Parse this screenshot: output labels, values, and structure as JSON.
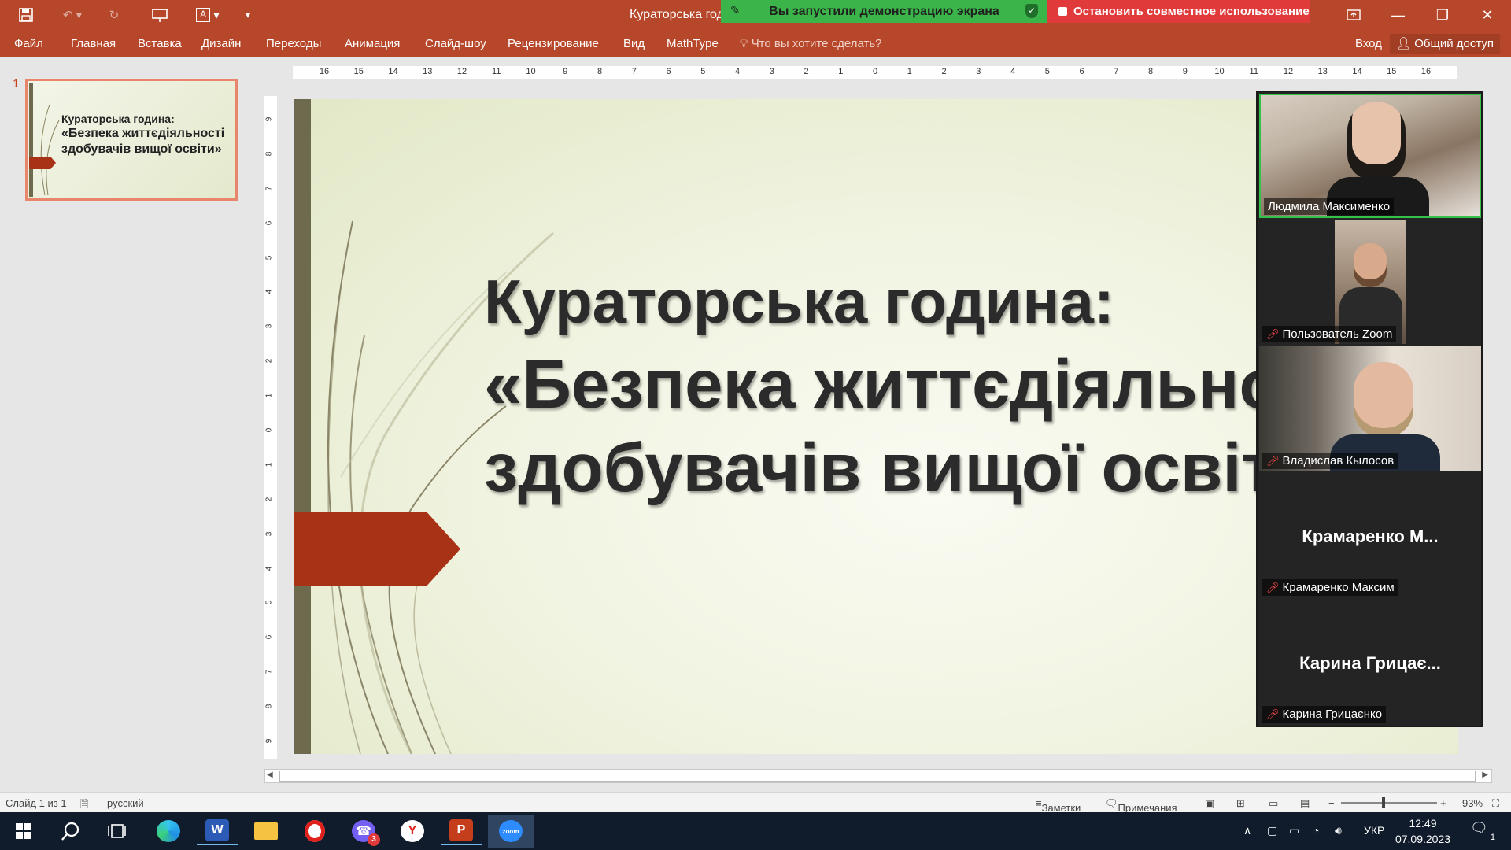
{
  "titlebar": {
    "doc_title": "Кураторська год",
    "share_status": "Вы запустили демонстрацию экрана",
    "stop_share": "Остановить совместное использование"
  },
  "ribbon": {
    "tabs": [
      "Файл",
      "Главная",
      "Вставка",
      "Дизайн",
      "Переходы",
      "Анимация",
      "Слайд-шоу",
      "Рецензирование",
      "Вид",
      "MathType"
    ],
    "tell_me": "Что вы хотите сделать?",
    "sign_in": "Вход",
    "share": "Общий доступ"
  },
  "thumbnail": {
    "number": "1",
    "line1": "Кураторська година:",
    "line2": "«Безпека життєдіяльності",
    "line3": "здобувачів вищої освіти»"
  },
  "slide": {
    "title_line1": "Кураторська година:",
    "title_line2": "«Безпека життєдіяльності",
    "title_line3": "здобувачів вищої освіти»"
  },
  "ruler": {
    "h_labels": [
      "16",
      "15",
      "14",
      "13",
      "12",
      "11",
      "10",
      "9",
      "8",
      "7",
      "6",
      "5",
      "4",
      "3",
      "2",
      "1",
      "0",
      "1",
      "2",
      "3",
      "4",
      "5",
      "6",
      "7",
      "8",
      "9",
      "10",
      "11",
      "12",
      "13",
      "14",
      "15",
      "16"
    ],
    "v_labels": [
      "9",
      "8",
      "7",
      "6",
      "5",
      "4",
      "3",
      "2",
      "1",
      "0",
      "1",
      "2",
      "3",
      "4",
      "5",
      "6",
      "7",
      "8",
      "9"
    ]
  },
  "zoom": {
    "participants": [
      {
        "name": "Людмила Максименко",
        "muted": false,
        "video": true,
        "big": ""
      },
      {
        "name": "Пользователь Zoom",
        "muted": true,
        "video": true,
        "big": ""
      },
      {
        "name": "Владислав Кылосов",
        "muted": true,
        "video": true,
        "big": ""
      },
      {
        "name": "Крамаренко Максим",
        "muted": true,
        "video": false,
        "big": "Крамаренко  М..."
      },
      {
        "name": "Карина Грицаєнко",
        "muted": true,
        "video": false,
        "big": "Карина  Грицає..."
      }
    ]
  },
  "status": {
    "slide": "Слайд 1 из 1",
    "language": "русский",
    "notes": "Заметки",
    "comments": "Примечания",
    "zoom": "93%"
  },
  "taskbar": {
    "lang": "УКР",
    "time": "12:49",
    "date": "07.09.2023",
    "viber_badge": "3",
    "notif_count": "1"
  },
  "colors": {
    "accent": "#b7472a",
    "share_green": "#3bb54a",
    "stop_red": "#e03a3a",
    "slide_bar": "#6e6a4e",
    "slide_arrow": "#a83216"
  }
}
